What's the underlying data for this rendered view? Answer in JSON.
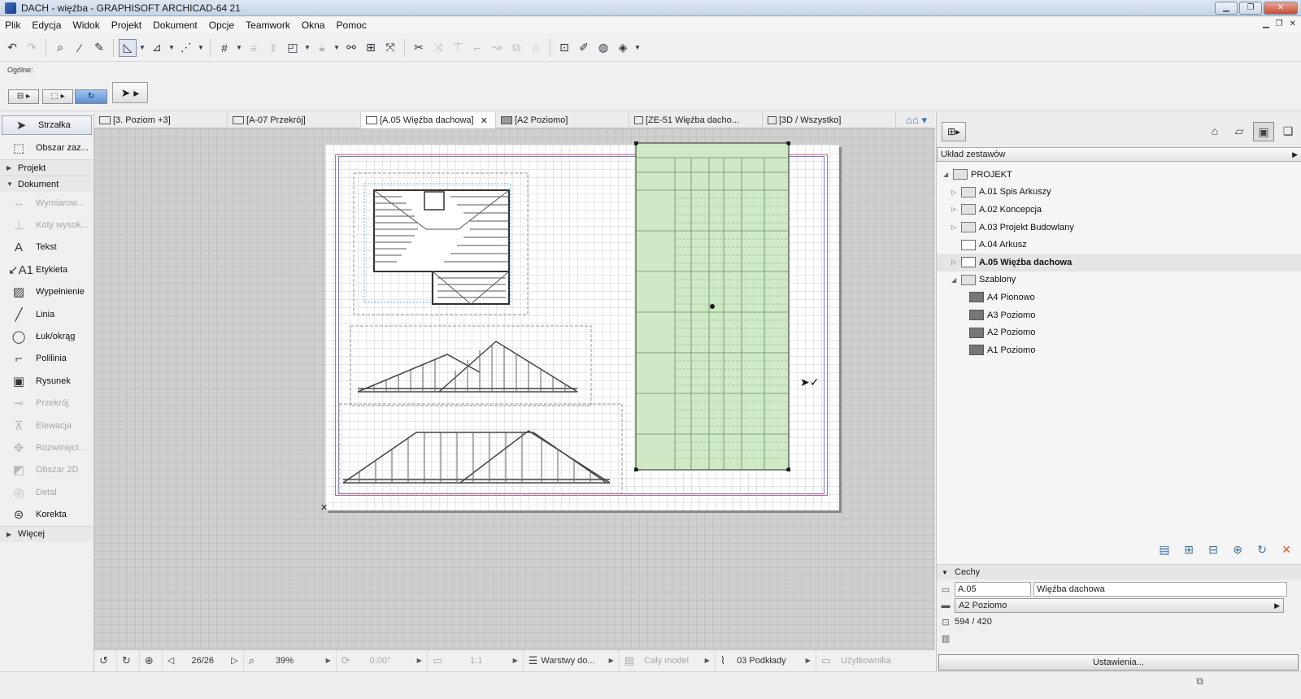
{
  "window": {
    "title": "DACH - więźba - GRAPHISOFT ARCHICAD-64 21",
    "buttons": {
      "minimize": "▁",
      "maximize": "❐",
      "close": "✕"
    }
  },
  "menu": [
    "Plik",
    "Edycja",
    "Widok",
    "Projekt",
    "Dokument",
    "Opcje",
    "Teamwork",
    "Okna",
    "Pomoc"
  ],
  "info_box": {
    "label": "Ogólne:"
  },
  "toolbox": {
    "tools_top": [
      {
        "label": "Strzałka",
        "icon": "arrow-pointer-icon",
        "glyph": "➤"
      },
      {
        "label": "Obszar zaz...",
        "icon": "marquee-icon",
        "glyph": "⬚"
      }
    ],
    "sections": {
      "projekt": "Projekt",
      "dokument": "Dokument",
      "wiecej": "Więcej"
    },
    "document_tools": [
      {
        "label": "Wymiarow...",
        "icon": "dimension-icon",
        "glyph": "↔",
        "enabled": false
      },
      {
        "label": "Koty wysok...",
        "icon": "level-dimension-icon",
        "glyph": "⊥",
        "enabled": false
      },
      {
        "label": "Tekst",
        "icon": "text-icon",
        "glyph": "A",
        "enabled": true
      },
      {
        "label": "Etykieta",
        "icon": "label-icon",
        "glyph": "↙A1",
        "enabled": true
      },
      {
        "label": "Wypełnienie",
        "icon": "fill-icon",
        "glyph": "▨",
        "enabled": true
      },
      {
        "label": "Linia",
        "icon": "line-icon",
        "glyph": "╱",
        "enabled": true
      },
      {
        "label": "Łuk/okrąg",
        "icon": "arc-icon",
        "glyph": "◯",
        "enabled": true
      },
      {
        "label": "Polilinia",
        "icon": "polyline-icon",
        "glyph": "⌐",
        "enabled": true
      },
      {
        "label": "Rysunek",
        "icon": "drawing-icon",
        "glyph": "▣",
        "enabled": true
      },
      {
        "label": "Przekrój",
        "icon": "section-icon",
        "glyph": "⊸",
        "enabled": false
      },
      {
        "label": "Elewacja",
        "icon": "elevation-icon",
        "glyph": "⊼",
        "enabled": false
      },
      {
        "label": "Rozwinięci...",
        "icon": "interior-elevation-icon",
        "glyph": "✥",
        "enabled": false
      },
      {
        "label": "Obszar 2D",
        "icon": "worksheet-icon",
        "glyph": "◩",
        "enabled": false
      },
      {
        "label": "Detal",
        "icon": "detail-icon",
        "glyph": "◎",
        "enabled": false
      },
      {
        "label": "Korekta",
        "icon": "change-icon",
        "glyph": "⊜",
        "enabled": true
      }
    ]
  },
  "tabs": [
    {
      "label": "[3. Poziom +3]",
      "icon": "floor-plan-tab-icon",
      "active": false
    },
    {
      "label": "[A-07 Przekrój]",
      "icon": "section-tab-icon",
      "active": false
    },
    {
      "label": "[A.05 Więźba dachowa]",
      "icon": "layout-tab-icon",
      "active": true
    },
    {
      "label": "[A2 Poziomo]",
      "icon": "master-layout-tab-icon",
      "active": false
    },
    {
      "label": "[ZE-51 Więźba dacho...",
      "icon": "schedule-tab-icon",
      "active": false
    },
    {
      "label": "[3D / Wszystko]",
      "icon": "3d-tab-icon",
      "active": false
    }
  ],
  "canvas_bar": {
    "page": "26/26",
    "zoom": "39%",
    "angle": "0,00°",
    "scale": "1:1",
    "layers": "Warstwy do...",
    "model": "Cały model",
    "pen_set": "03 Podkłady",
    "user": "Użytkownika"
  },
  "navigator": {
    "set_label": "Układ zestawów",
    "tree": [
      {
        "label": "PROJEKT",
        "level": 0,
        "expander": "◢",
        "kind": "project",
        "selected": false
      },
      {
        "label": "A.01 Spis Arkuszy",
        "level": 1,
        "expander": "▷",
        "kind": "folder",
        "selected": false
      },
      {
        "label": "A.02 Koncepcja",
        "level": 1,
        "expander": "▷",
        "kind": "folder",
        "selected": false
      },
      {
        "label": "A.03 Projekt Budowlany",
        "level": 1,
        "expander": "▷",
        "kind": "folder",
        "selected": false
      },
      {
        "label": "A.04 Arkusz",
        "level": 1,
        "expander": "",
        "kind": "layout",
        "selected": false
      },
      {
        "label": "A.05 Więźba dachowa",
        "level": 1,
        "expander": "▷",
        "kind": "layout",
        "selected": true
      },
      {
        "label": "Szablony",
        "level": 1,
        "expander": "◢",
        "kind": "folder",
        "selected": false
      },
      {
        "label": "A4 Pionowo",
        "level": 2,
        "expander": "",
        "kind": "tpl",
        "selected": false
      },
      {
        "label": "A3 Poziomo",
        "level": 2,
        "expander": "",
        "kind": "tpl",
        "selected": false
      },
      {
        "label": "A2 Poziomo",
        "level": 2,
        "expander": "",
        "kind": "tpl",
        "selected": false
      },
      {
        "label": "A1 Poziomo",
        "level": 2,
        "expander": "",
        "kind": "tpl",
        "selected": false
      }
    ],
    "properties": {
      "header": "Cechy",
      "id": "A.05",
      "name": "Więźba dachowa",
      "master": "A2 Poziomo",
      "size": "594 / 420",
      "settings_button": "Ustawienia..."
    }
  },
  "colors": {
    "accent": "#3a6fc7",
    "selection_green": "#cfe9c4",
    "delete_orange": "#e25b1f"
  }
}
